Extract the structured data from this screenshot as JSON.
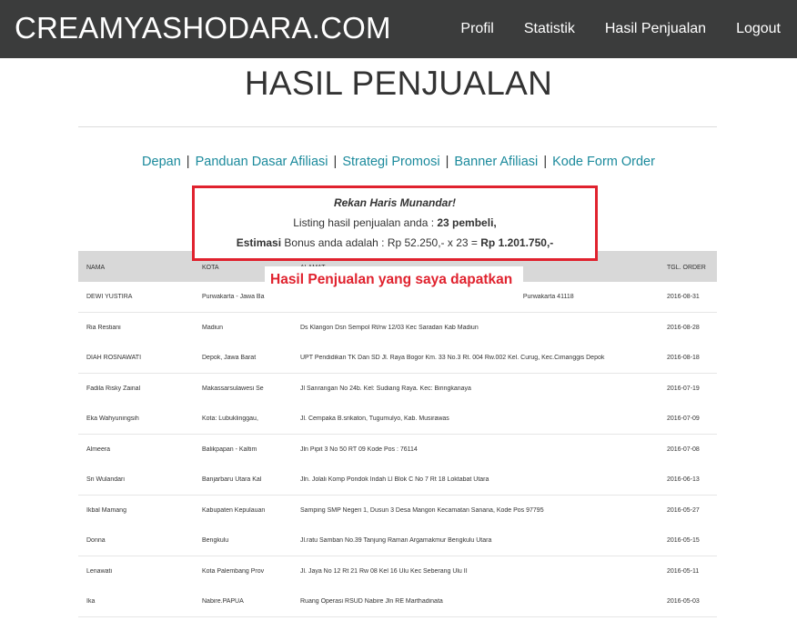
{
  "navbar": {
    "brand": "CREAMYASHODARA.COM",
    "links": [
      "Profil",
      "Statistik",
      "Hasil Penjualan",
      "Logout"
    ]
  },
  "page": {
    "title": "HASIL PENJUALAN"
  },
  "subnav": {
    "links": [
      "Depan",
      "Panduan Dasar Afiliasi",
      "Strategi Promosi",
      "Banner Afiliasi",
      "Kode Form Order"
    ],
    "separator": "|"
  },
  "summary": {
    "greeting": "Rekan Haris Munandar!",
    "listing_prefix": "Listing hasil penjualan anda : ",
    "listing_count": "23 pembeli,",
    "estimasi_label": "Estimasi",
    "bonus_text": " Bonus anda adalah : Rp 52.250,- x 23 = ",
    "bonus_total": "Rp 1.201.750,-"
  },
  "annotation": {
    "text": "Hasil Penjualan yang saya dapatkan",
    "color": "#e0222e"
  },
  "table": {
    "headers": {
      "nama": "NAMA",
      "kota": "KOTA",
      "alamat": "ALAMAT",
      "tgl": "TGL. ORDER"
    },
    "rows": [
      {
        "nama": "DEWI YUSTIRA",
        "kota": "Purwakarta - Jawa Ba",
        "alamat": "h Purwakarta 41118",
        "tgl": "2016-08-31"
      },
      {
        "nama": "Ria Restiani",
        "kota": "Madiun",
        "alamat": "Ds Klangon Dsn Sempol Rt/rw 12/03 Kec Saradan Kab Madiun",
        "tgl": "2016-08-28"
      },
      {
        "nama": "DIAH ROSNAWATI",
        "kota": "Depok, Jawa Barat",
        "alamat": "UPT Pendidikan TK Dan SD Jl. Raya Bogor Km. 33 No.3 Rt. 004 Rw.002 Kel. Curug, Kec.Cimanggis Depok",
        "tgl": "2016-08-18"
      },
      {
        "nama": "Fadila Risky Zainal",
        "kota": "Makassarsulawesi Se",
        "alamat": "Jl Sanrangan No 24b. Kel: Sudiang Raya. Kec: Biringkanaya",
        "tgl": "2016-07-19"
      },
      {
        "nama": "Eka Wahyuningsih",
        "kota": "Kota: Lubuklinggau,",
        "alamat": "Jl. Cempaka B.srikaton, Tugumulyo, Kab. Musirawas",
        "tgl": "2016-07-09"
      },
      {
        "nama": "Almeera",
        "kota": "Balikpapan - Kaltim",
        "alamat": "Jln Pipit 3 No 50 RT 09 Kode Pos : 76114",
        "tgl": "2016-07-08"
      },
      {
        "nama": "Sri Wulandari",
        "kota": "Banjarbaru Utara Kal",
        "alamat": "Jln. Jolali Komp Pondok Indah Ll Blok C No 7 Rt 18 Loktabat Utara",
        "tgl": "2016-06-13"
      },
      {
        "nama": "Ikbal Mamang",
        "kota": "Kabupaten Kepulauan",
        "alamat": "Samping SMP Negeri 1, Dusun 3 Desa Mangon Kecamatan Sanana, Kode Pos 97795",
        "tgl": "2016-05-27"
      },
      {
        "nama": "Donna",
        "kota": "Bengkulu",
        "alamat": "Jl.ratu Samban No.39 Tanjung Raman Argamakmur Bengkulu Utara",
        "tgl": "2016-05-15"
      },
      {
        "nama": "Lenawati",
        "kota": "Kota Palembang Prov",
        "alamat": "Jl. Jaya No 12 Rt 21 Rw 08 Kel 16 Ulu Kec Seberang Ulu II",
        "tgl": "2016-05-11"
      },
      {
        "nama": "Ika",
        "kota": "Nabire.PAPUA",
        "alamat": "Ruang Operasi RSUD Nabire Jln RE Marthadinata",
        "tgl": "2016-05-03"
      }
    ]
  },
  "colors": {
    "navbar_bg": "#3b3c3c",
    "link": "#1b8a9c",
    "highlight_border": "#e0222e",
    "table_header_bg": "#d8d8d8"
  }
}
